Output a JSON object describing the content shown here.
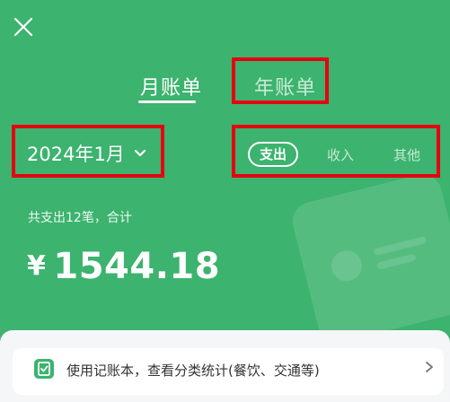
{
  "header": {
    "close_icon": "close-icon"
  },
  "tabs": {
    "month": "月账单",
    "year": "年账单"
  },
  "filters": {
    "date": "2024年1月",
    "date_icon": "chevron-down-icon",
    "expense": "支出",
    "income": "收入",
    "other": "其他"
  },
  "summary": {
    "text": "共支出12笔，合计",
    "currency": "¥",
    "amount": "1544.18"
  },
  "banner": {
    "icon": "ledger-icon",
    "text": "使用记账本，查看分类统计(餐饮、交通等)",
    "arrow_icon": "chevron-right-icon"
  },
  "colors": {
    "background": "#3cb36e",
    "highlight": "#e60012",
    "sheet": "#f5f6f7"
  }
}
